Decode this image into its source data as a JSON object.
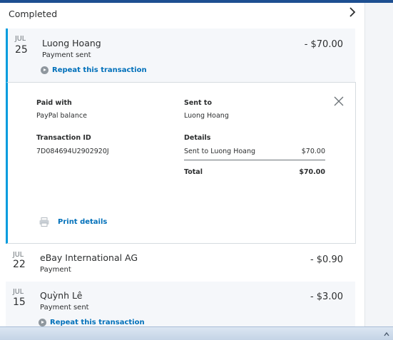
{
  "section": {
    "title": "Completed"
  },
  "transactions": [
    {
      "month": "JUL",
      "day": "25",
      "name": "Luong Hoang",
      "subtitle": "Payment sent",
      "amount": "- $70.00",
      "repeat_label": "Repeat this transaction"
    },
    {
      "month": "JUL",
      "day": "22",
      "name": "eBay International AG",
      "subtitle": "Payment",
      "amount": "- $0.90"
    },
    {
      "month": "JUL",
      "day": "15",
      "name": "Quỳnh Lê",
      "subtitle": "Payment sent",
      "amount": "- $3.00",
      "repeat_label": "Repeat this transaction"
    }
  ],
  "details": {
    "paid_with_label": "Paid with",
    "paid_with_value": "PayPal balance",
    "transaction_id_label": "Transaction ID",
    "transaction_id_value": "7D084694U2902920J",
    "sent_to_label": "Sent to",
    "sent_to_value": "Luong Hoang",
    "details_label": "Details",
    "line_item_label": "Sent to Luong Hoang",
    "line_item_amount": "$70.00",
    "total_label": "Total",
    "total_amount": "$70.00",
    "print_label": "Print details"
  },
  "icons": {
    "chevron": "chevron-right-icon",
    "close": "close-icon",
    "repeat": "repeat-icon",
    "print": "printer-icon"
  },
  "colors": {
    "accent": "#009cde",
    "link": "#0070ba",
    "row_bg": "#f5f7fa",
    "text": "#2c2e2f"
  }
}
